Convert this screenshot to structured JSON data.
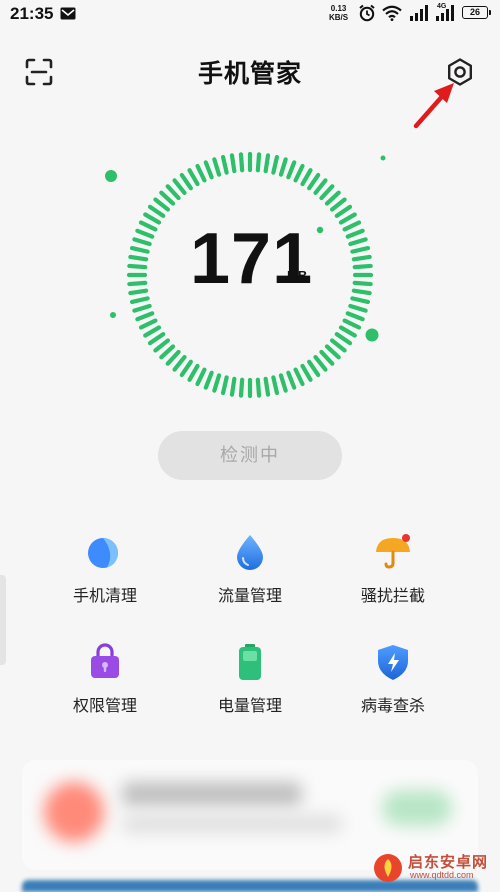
{
  "status_bar": {
    "time": "21:35",
    "net_speed_value": "0.13",
    "net_speed_unit": "KB/S",
    "network_type": "4G",
    "battery_level": "26",
    "icons": [
      "message-icon",
      "alarm-icon",
      "wifi-icon",
      "signal-icon",
      "signal-icon",
      "battery-icon"
    ]
  },
  "header": {
    "title": "手机管家",
    "left_icon": "scan-icon",
    "right_icon": "settings-gear-icon"
  },
  "gauge": {
    "value": "171",
    "unit": "MB",
    "accent_color": "#2dbf6a"
  },
  "detect_button": {
    "label": "检测中",
    "state": "disabled"
  },
  "features": [
    {
      "label": "手机清理",
      "icon": "cleanup-icon",
      "color": "#3d8bfd"
    },
    {
      "label": "流量管理",
      "icon": "water-drop-icon",
      "color": "#2f7fe8"
    },
    {
      "label": "骚扰拦截",
      "icon": "umbrella-icon",
      "color": "#f5a623"
    },
    {
      "label": "权限管理",
      "icon": "lock-bag-icon",
      "color": "#8a3ed8"
    },
    {
      "label": "电量管理",
      "icon": "battery-icon",
      "color": "#2ec07a"
    },
    {
      "label": "病毒查杀",
      "icon": "shield-icon",
      "color": "#2f7fe8"
    }
  ],
  "watermark": {
    "name": "启东安卓网",
    "url": "www.qdtdd.com"
  }
}
